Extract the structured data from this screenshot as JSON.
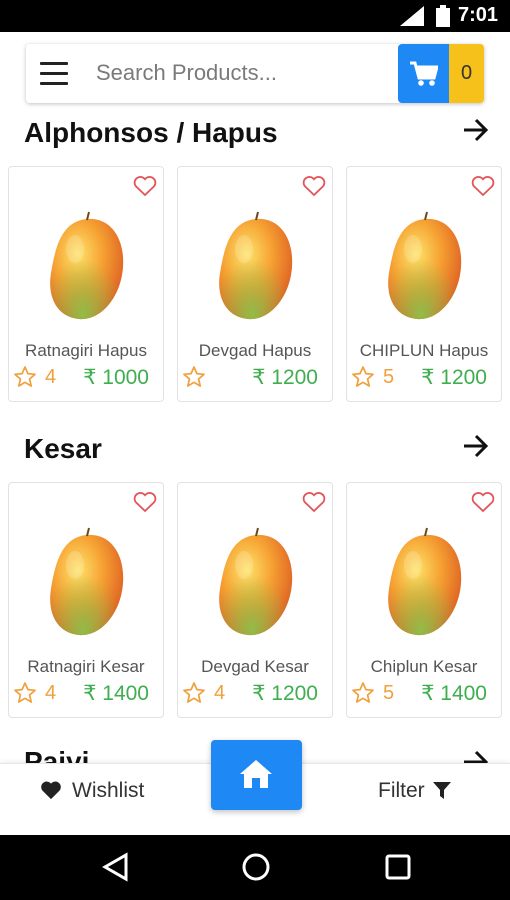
{
  "status_bar": {
    "time": "7:01"
  },
  "search": {
    "placeholder": "Search Products...",
    "cart_count": "0"
  },
  "sections": [
    {
      "title": "Alphonsos / Hapus",
      "products": [
        {
          "name": "Ratnagiri Hapus",
          "rating": "4",
          "price": "₹ 1000"
        },
        {
          "name": "Devgad Hapus",
          "rating": "",
          "price": "₹ 1200"
        },
        {
          "name": "CHIPLUN Hapus",
          "rating": "5",
          "price": "₹ 1200"
        }
      ]
    },
    {
      "title": "Kesar",
      "products": [
        {
          "name": "Ratnagiri Kesar",
          "rating": "4",
          "price": "₹ 1400"
        },
        {
          "name": "Devgad Kesar",
          "rating": "4",
          "price": "₹ 1200"
        },
        {
          "name": "Chiplun Kesar",
          "rating": "5",
          "price": "₹ 1400"
        }
      ]
    },
    {
      "title": "Paiyi"
    }
  ],
  "bottom_nav": {
    "wishlist": "Wishlist",
    "filter": "Filter"
  },
  "colors": {
    "accent": "#1e88f5",
    "cart_badge": "#f7c11c",
    "price": "#3fae4f",
    "rating": "#f0a03c",
    "heart": "#e2555a"
  },
  "icons": [
    "menu-icon",
    "cart-icon",
    "arrow-right-icon",
    "heart-outline-icon",
    "star-outline-icon",
    "heart-filled-icon",
    "home-icon",
    "filter-icon",
    "back-icon",
    "home-circle-icon",
    "recents-icon"
  ]
}
